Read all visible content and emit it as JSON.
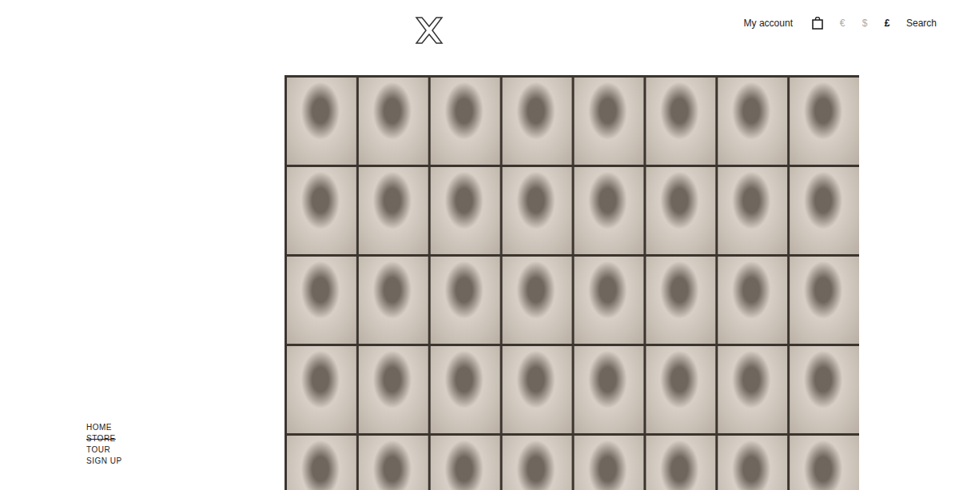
{
  "header": {
    "account": "My account",
    "currencies": [
      {
        "label": "€",
        "selected": false
      },
      {
        "label": "$",
        "selected": false
      },
      {
        "label": "£",
        "selected": true
      }
    ],
    "search": "Search"
  },
  "nav": [
    {
      "label": "HOME",
      "selected": false
    },
    {
      "label": "STORE",
      "selected": true
    },
    {
      "label": "TOUR",
      "selected": false
    },
    {
      "label": "SIGN UP",
      "selected": false
    }
  ]
}
